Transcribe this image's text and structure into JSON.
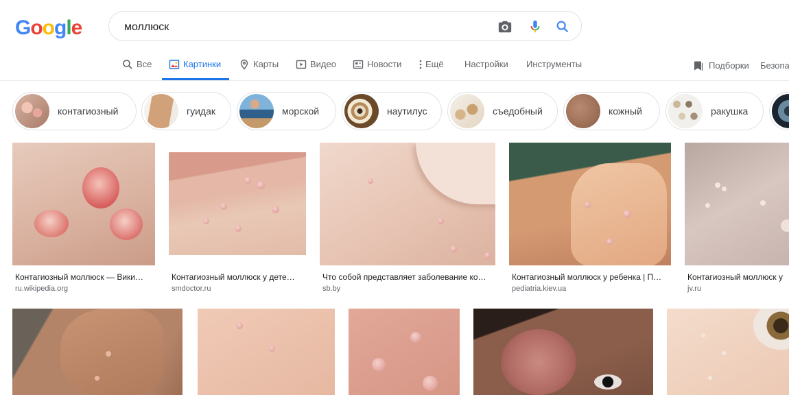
{
  "logo": [
    "G",
    "o",
    "o",
    "g",
    "l",
    "e"
  ],
  "colors": {
    "blue": "#4285f4",
    "red": "#ea4335",
    "yellow": "#fbbc05",
    "green": "#34a853",
    "active_tab": "#1a73e8"
  },
  "search": {
    "value": "моллюск",
    "icons": [
      "camera-icon",
      "microphone-icon",
      "search-icon"
    ]
  },
  "tabs": [
    {
      "label": "Все",
      "icon": "search-icon"
    },
    {
      "label": "Картинки",
      "icon": "images-icon",
      "active": true
    },
    {
      "label": "Карты",
      "icon": "map-pin-icon"
    },
    {
      "label": "Видео",
      "icon": "play-icon"
    },
    {
      "label": "Новости",
      "icon": "news-icon"
    },
    {
      "label": "Ещё",
      "icon": "more-vert-icon"
    },
    {
      "label": "Настройки"
    },
    {
      "label": "Инструменты"
    }
  ],
  "right_tabs": {
    "collections": "Подборки",
    "safe": "Безопа"
  },
  "chips": [
    "контагиозный",
    "гуидак",
    "морской",
    "наутилус",
    "съедобный",
    "кожный",
    "ракушка"
  ],
  "results_row1": [
    {
      "caption": "Контагиозный моллюск — Вики…",
      "domain": "ru.wikipedia.org"
    },
    {
      "caption": "Контагиозный моллюск у дете…",
      "domain": "smdoctor.ru"
    },
    {
      "caption": "Что собой представляет заболевание ко…",
      "domain": "sb.by"
    },
    {
      "caption": "Контагиозный моллюск у ребенка | П…",
      "domain": "pediatria.kiev.ua"
    },
    {
      "caption": "Контагиозный моллюск у",
      "domain": "jv.ru"
    }
  ]
}
